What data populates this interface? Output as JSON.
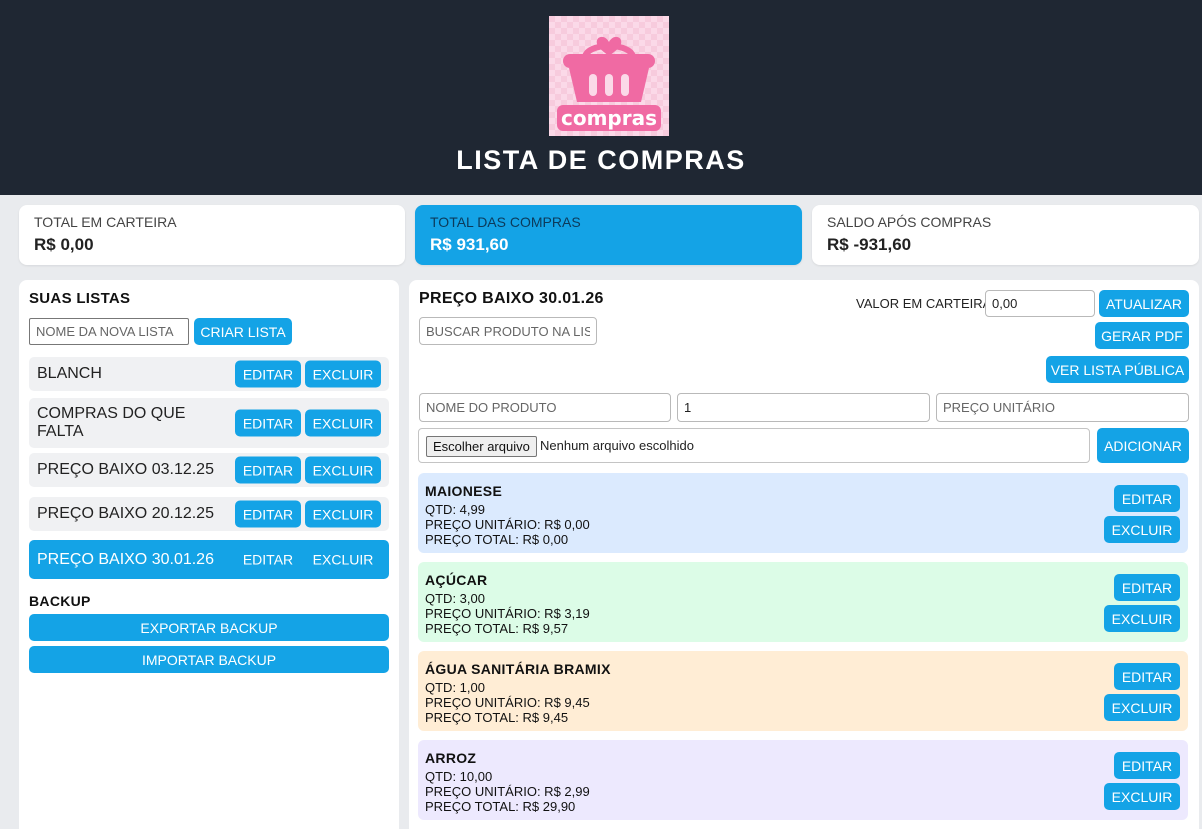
{
  "header": {
    "logo_text": "compras",
    "title": "LISTA DE COMPRAS"
  },
  "summary": {
    "wallet_label": "TOTAL EM CARTEIRA",
    "wallet_value": "R$ 0,00",
    "purchases_label": "TOTAL DAS COMPRAS",
    "purchases_value": "R$ 931,60",
    "balance_label": "SALDO APÓS COMPRAS",
    "balance_value": "R$ -931,60"
  },
  "sidebar": {
    "title": "SUAS LISTAS",
    "new_list_placeholder": "NOME DA NOVA LISTA",
    "create_label": "CRIAR LISTA",
    "edit_label": "EDITAR",
    "delete_label": "EXCLUIR",
    "lists": [
      {
        "name": "BLANCH"
      },
      {
        "name": "COMPRAS DO QUE FALTA"
      },
      {
        "name": "PREÇO BAIXO 03.12.25"
      },
      {
        "name": "PREÇO BAIXO 20.12.25"
      },
      {
        "name": "PREÇO BAIXO 30.01.26"
      }
    ],
    "active_index": 4,
    "backup_title": "BACKUP",
    "export_label": "EXPORTAR BACKUP",
    "import_label": "IMPORTAR BACKUP"
  },
  "main": {
    "list_title": "PREÇO BAIXO 30.01.26",
    "search_placeholder": "BUSCAR PRODUTO NA LISTA",
    "wallet_label": "VALOR EM CARTEIRA",
    "wallet_value": "0,00",
    "update_label": "ATUALIZAR",
    "pdf_label": "GERAR PDF",
    "public_label": "VER LISTA PÚBLICA",
    "product_name_placeholder": "NOME DO PRODUTO",
    "quantity_value": "1",
    "unit_price_placeholder": "PREÇO UNITÁRIO",
    "file_button_label": "Escolher arquivo",
    "file_status": "Nenhum arquivo escolhido",
    "add_label": "ADICIONAR",
    "edit_label": "EDITAR",
    "delete_label": "EXCLUIR",
    "products": [
      {
        "name": "MAIONESE",
        "qty": "QTD: 4,99",
        "unit": "PREÇO UNITÁRIO: R$ 0,00",
        "total": "PREÇO TOTAL: R$ 0,00",
        "color": "#dbeafe"
      },
      {
        "name": "AÇÚCAR",
        "qty": "QTD: 3,00",
        "unit": "PREÇO UNITÁRIO: R$ 3,19",
        "total": "PREÇO TOTAL: R$ 9,57",
        "color": "#dcfce7"
      },
      {
        "name": "ÁGUA SANITÁRIA BRAMIX",
        "qty": "QTD: 1,00",
        "unit": "PREÇO UNITÁRIO: R$ 9,45",
        "total": "PREÇO TOTAL: R$ 9,45",
        "color": "#ffedd5"
      },
      {
        "name": "ARROZ",
        "qty": "QTD: 10,00",
        "unit": "PREÇO UNITÁRIO: R$ 2,99",
        "total": "PREÇO TOTAL: R$ 29,90",
        "color": "#ede9fe"
      }
    ]
  },
  "colors": {
    "header_bg": "#1f2733",
    "accent": "#14a3e6",
    "page_bg": "#e9ebee"
  }
}
